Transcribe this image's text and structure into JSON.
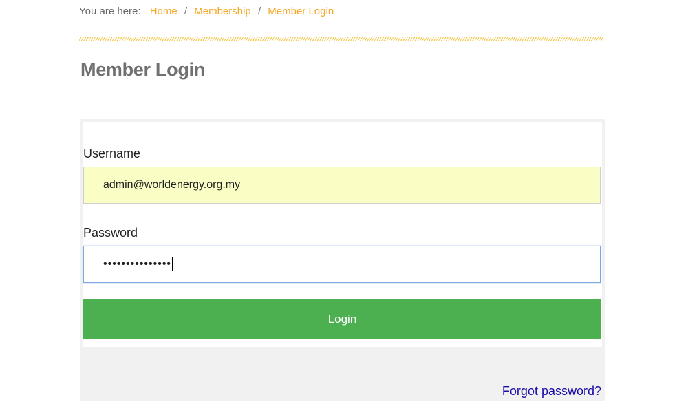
{
  "breadcrumb": {
    "prefix": "You are here:",
    "items": [
      "Home",
      "Membership",
      "Member Login"
    ],
    "separator": "/"
  },
  "page": {
    "title": "Member Login"
  },
  "form": {
    "username_label": "Username",
    "username_value": "admin@worldenergy.org.my",
    "password_label": "Password",
    "password_masked": "•••••••••••••••",
    "login_label": "Login",
    "forgot_label": "Forgot password?"
  },
  "colors": {
    "accent": "#f5a623",
    "button": "#4caf50",
    "autofill": "#fafdc4",
    "link": "#1a0dab"
  }
}
